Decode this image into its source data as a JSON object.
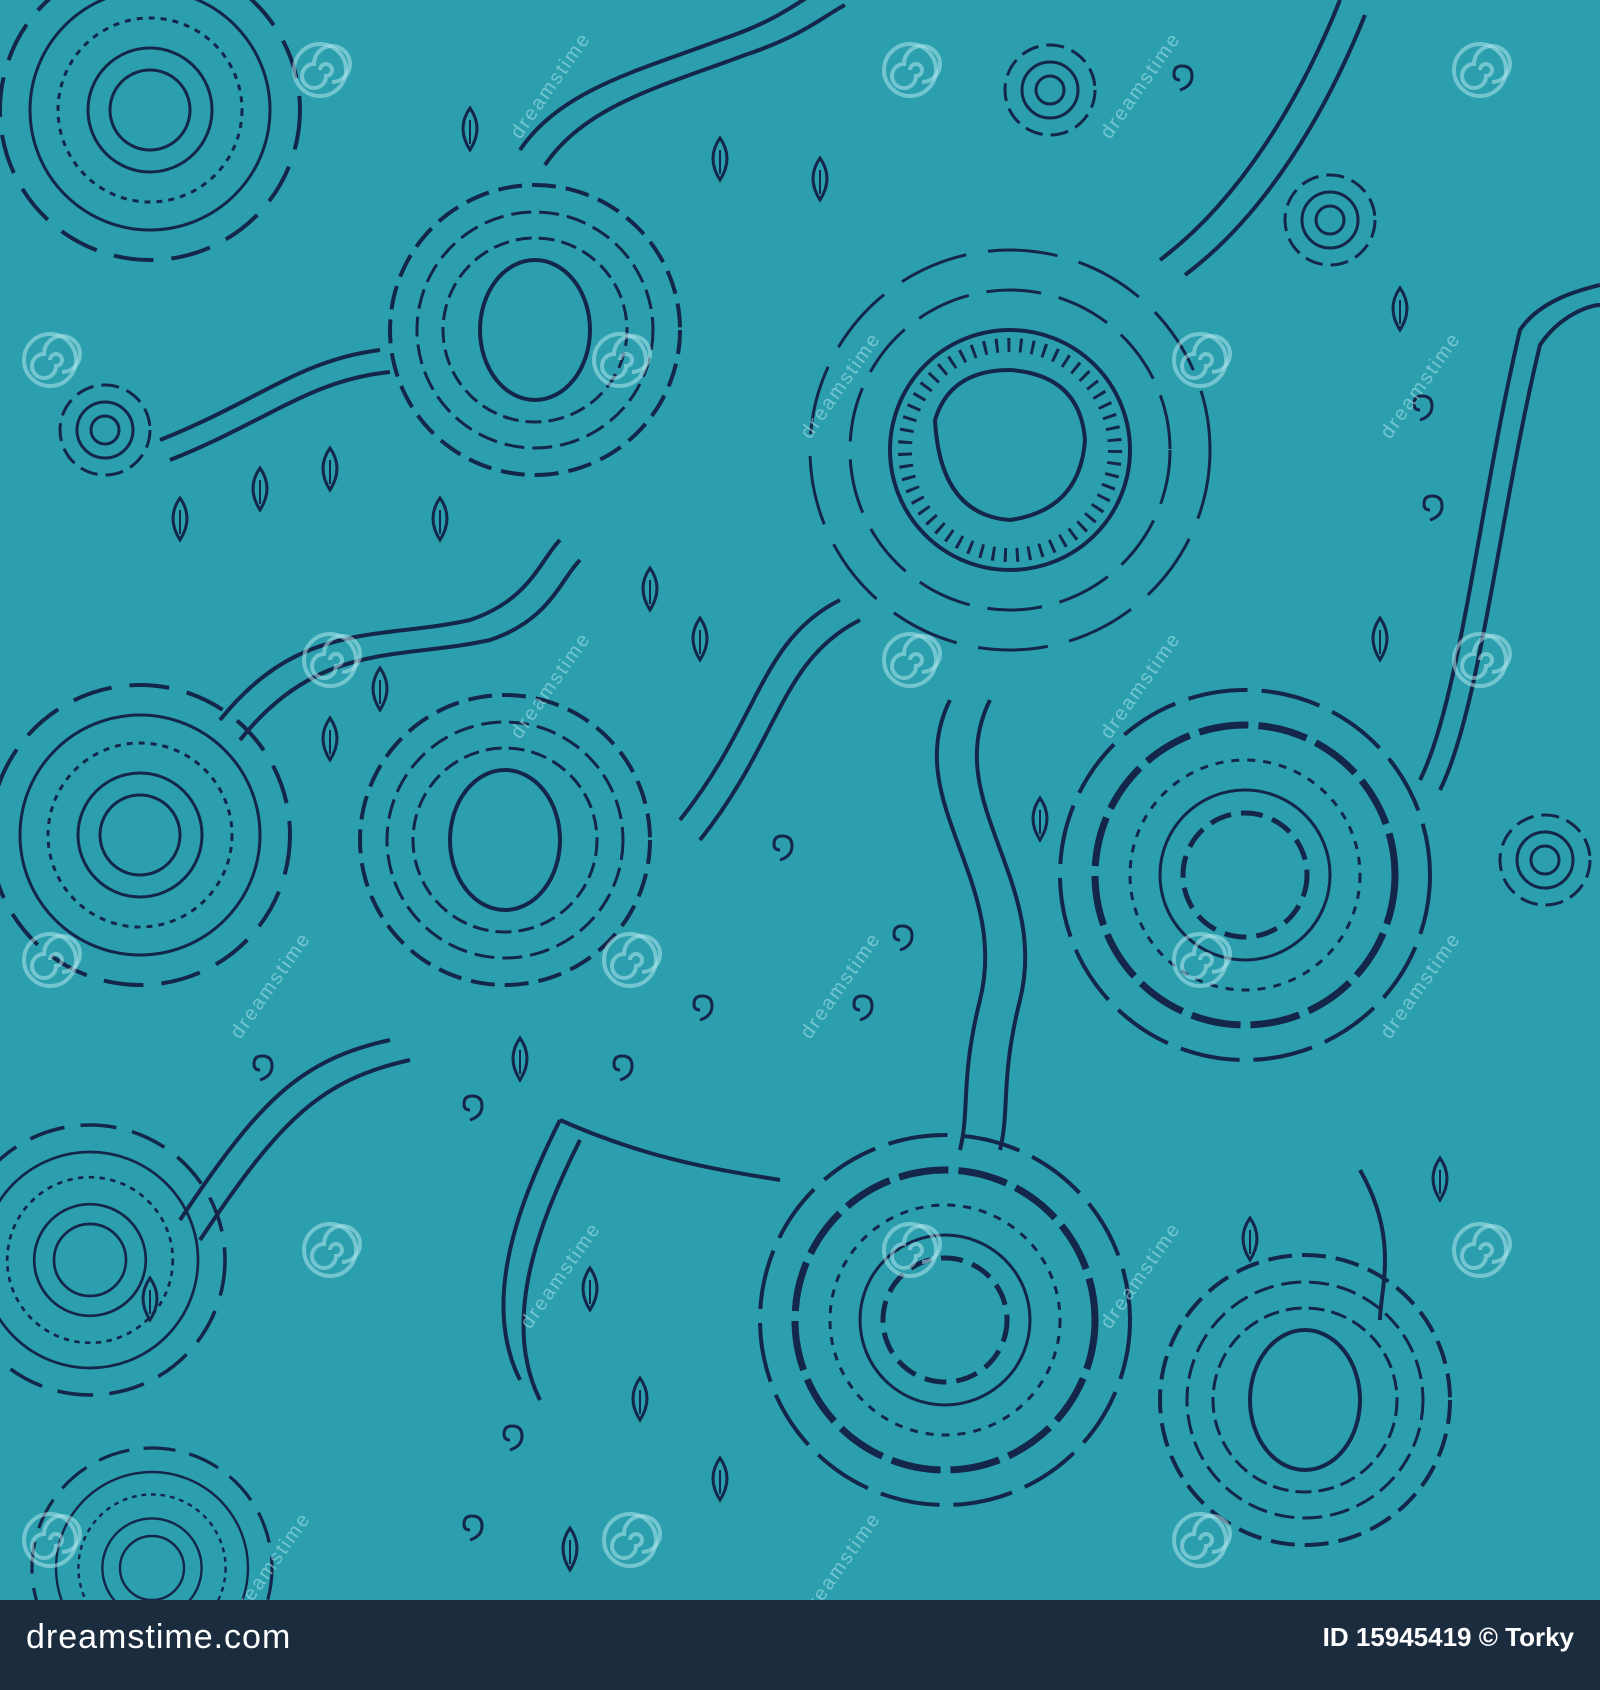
{
  "artwork": {
    "background_color": "#2b9fae",
    "line_color": "#14264a",
    "watermark_color": "#aee6ec",
    "watermark_text": "dreamstime",
    "watermark_icon": "spiral-icon"
  },
  "footer": {
    "background_color": "#1c2c3f",
    "site_name": "dreamstime.com",
    "image_id": "ID 15945419",
    "author": "© Torky"
  }
}
